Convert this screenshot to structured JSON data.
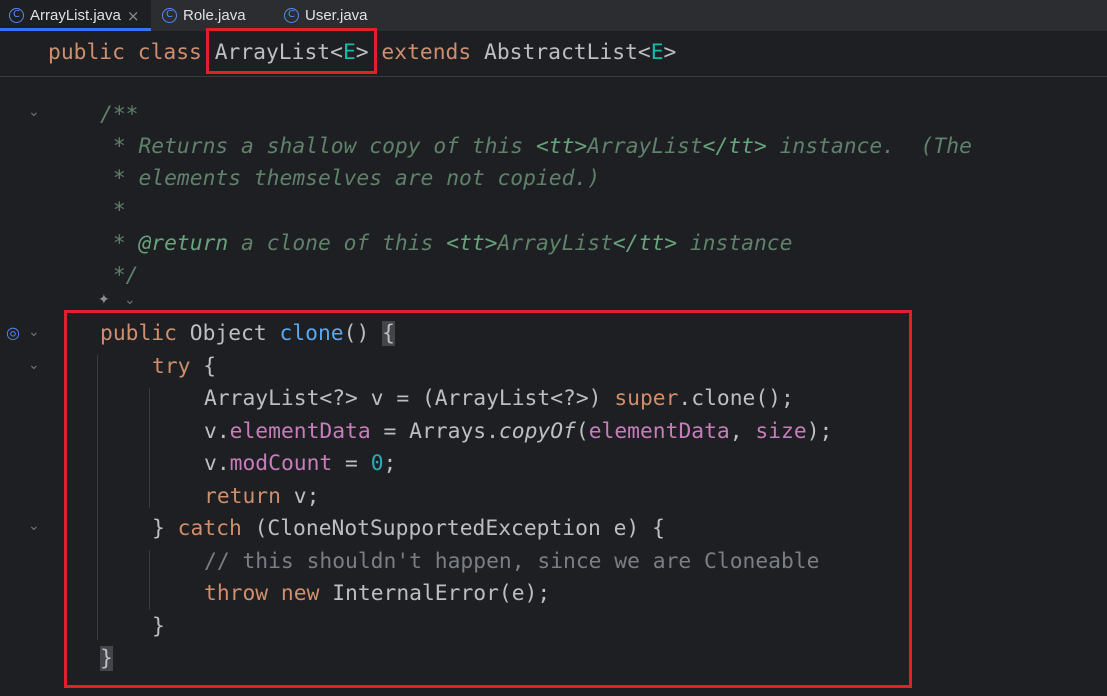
{
  "tabs": [
    {
      "icon": "class-icon",
      "icon_glyph": "C",
      "label": "ArrayList.java",
      "close": "×",
      "active": true
    },
    {
      "icon": "class-icon",
      "icon_glyph": "C",
      "label": "Role.java",
      "active": false
    },
    {
      "icon": "class-icon",
      "icon_glyph": "C",
      "label": "User.java",
      "active": false
    }
  ],
  "sticky": {
    "kw_public": "public",
    "kw_class": "class",
    "class_name": "ArrayList",
    "lt1": "<",
    "type_param": "E",
    "gt1": ">",
    "kw_extends": "extends",
    "super_name": "AbstractList",
    "lt2": "<",
    "type_param2": "E",
    "gt2": ">"
  },
  "javadoc": {
    "open": "/**",
    "l1_a": " * Returns a shallow copy of this ",
    "l1_tt1": "<tt>",
    "l1_b": "ArrayList",
    "l1_tt2": "</tt>",
    "l1_c": " instance.  (The",
    "l2": " * elements themselves are not copied.)",
    "l3": " *",
    "l4_a": " * ",
    "l4_tag": "@return",
    "l4_b": " a clone of this ",
    "l4_tt1": "<tt>",
    "l4_c": "ArrayList",
    "l4_tt2": "</tt>",
    "l4_d": " instance",
    "close": " */"
  },
  "code": {
    "m_public": "public",
    "m_type": " Object ",
    "m_name": "clone",
    "m_parens": "() ",
    "m_brace": "{",
    "try_kw": "try",
    "try_brace": " {",
    "l1_a": "ArrayList<?> v = (ArrayList<?>) ",
    "l1_super": "super",
    "l1_b": ".clone();",
    "l2_a": "v.",
    "l2_field": "elementData",
    "l2_b": " = Arrays.",
    "l2_method": "copyOf",
    "l2_c": "(",
    "l2_field2": "elementData",
    "l2_d": ", ",
    "l2_field3": "size",
    "l2_e": ");",
    "l3_a": "v.",
    "l3_field": "modCount",
    "l3_b": " = ",
    "l3_num": "0",
    "l3_c": ";",
    "l4_kw": "return",
    "l4_b": " v;",
    "catch_a": "} ",
    "catch_kw": "catch",
    "catch_b": " (CloneNotSupportedException e) {",
    "comment": "// this shouldn't happen, since we are Cloneable",
    "throw_kw": "throw",
    "new_kw": " new",
    "throw_b": " InternalError(e);",
    "close_inner": "}",
    "close_method": "}"
  }
}
